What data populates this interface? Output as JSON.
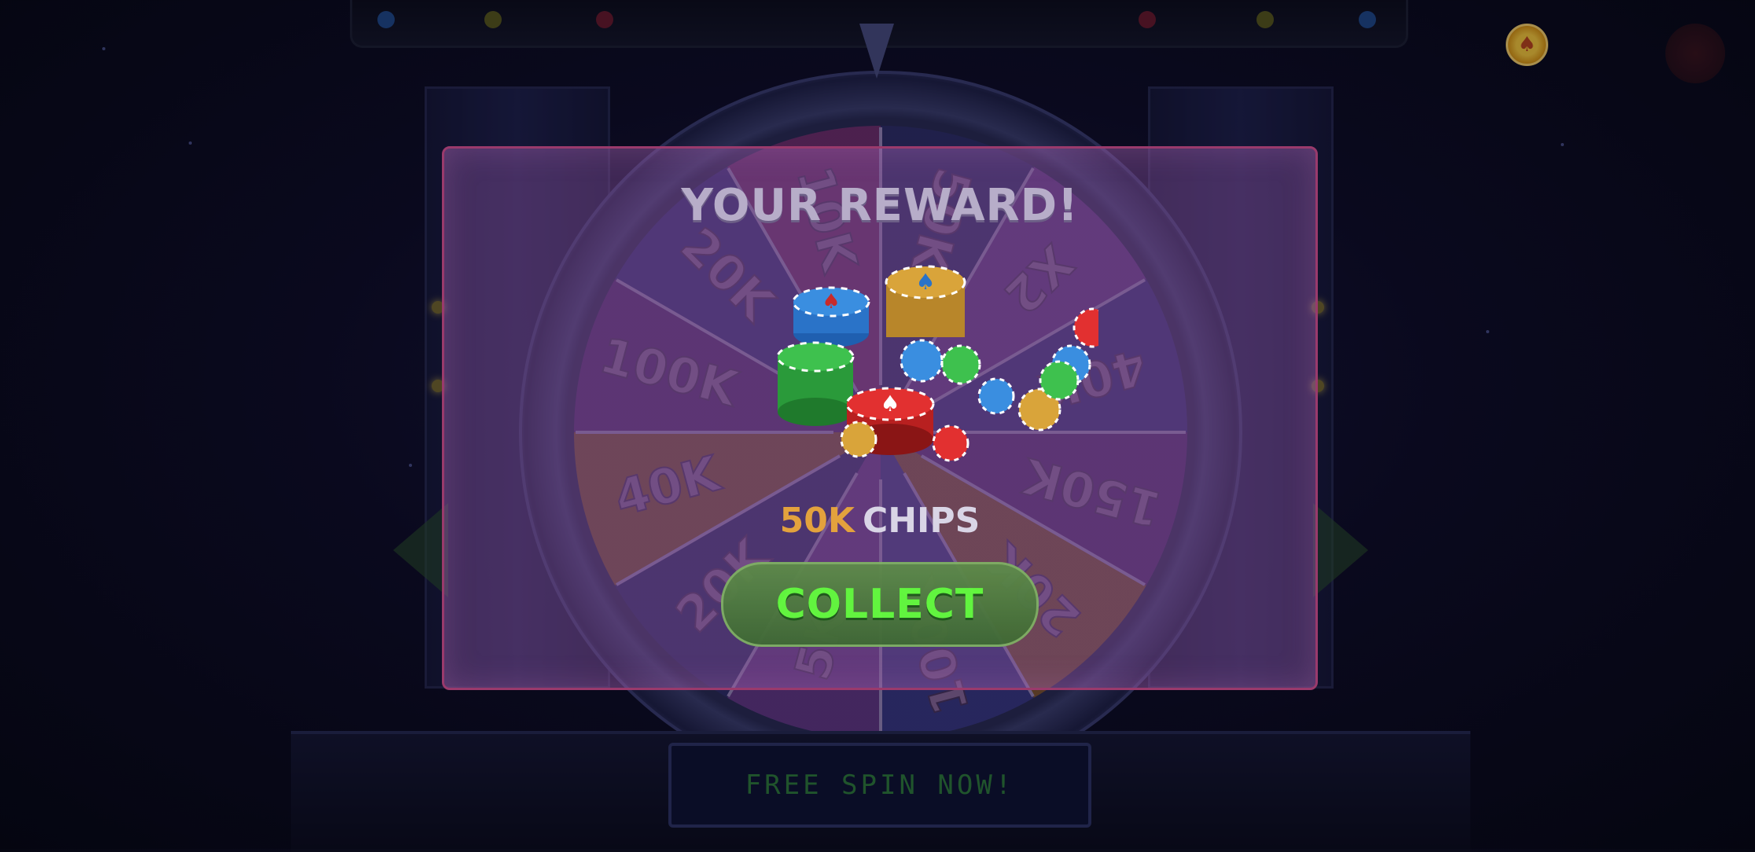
{
  "reward_popup": {
    "title": "YOUR REWARD!",
    "amount": "50K",
    "unit": "CHIPS",
    "collect_label": "COLLECT"
  },
  "wheel": {
    "segments": [
      "50K",
      "X2",
      "40K",
      "150K",
      "20K",
      "100K",
      "5K",
      "20K",
      "40K",
      "100K",
      "20K",
      "10K"
    ]
  },
  "footer": {
    "free_spin_label": "FREE SPIN NOW!"
  },
  "colors": {
    "collect_text": "#62ff3c",
    "amount": "#e3a23d",
    "panel_border": "#9a3a6c"
  },
  "icons": [
    "coin-icon",
    "spade-icon",
    "chip-stack-icon",
    "wheel-pointer-icon"
  ]
}
